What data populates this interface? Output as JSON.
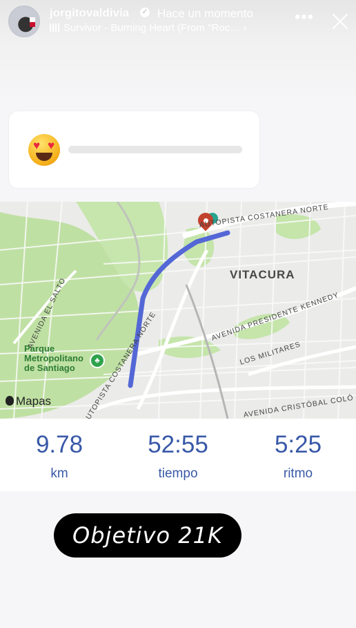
{
  "story": {
    "username": "jorgitovaldivia",
    "time": "Hace un momento",
    "music_track": "Survivor - Burning Heart (From \"Roc…",
    "more_label": "•••"
  },
  "poll": {
    "emoji": "heart-eyes-emoji",
    "slider_value": 0
  },
  "map": {
    "district": "VITACURA",
    "park_name": "Parque\nMetropolitano\nde Santiago",
    "brand": "Mapas",
    "streets": {
      "costanera_norte_top": "AUTOPISTA COSTANERA NORTE",
      "kennedy": "AVENIDA PRESIDENTE KENNEDY",
      "los_militares": "LOS MILITARES",
      "cristobal_colon": "AVENIDA CRISTÓBAL COLÓ",
      "el_salto": "AVENIDA EL SALTO",
      "costanera_norte_bottom": "AUTOPISTA COSTANERA NORTE"
    },
    "colors": {
      "route": "#5367d6",
      "park": "#bfe0a3",
      "roads": "#ffffff"
    }
  },
  "stats": [
    {
      "value": "9.78",
      "label": "km"
    },
    {
      "value": "52:55",
      "label": "tiempo"
    },
    {
      "value": "5:25",
      "label": "ritmo"
    }
  ],
  "goal": {
    "text": "Objetivo 21K"
  },
  "colors": {
    "accent": "#3858a7"
  }
}
